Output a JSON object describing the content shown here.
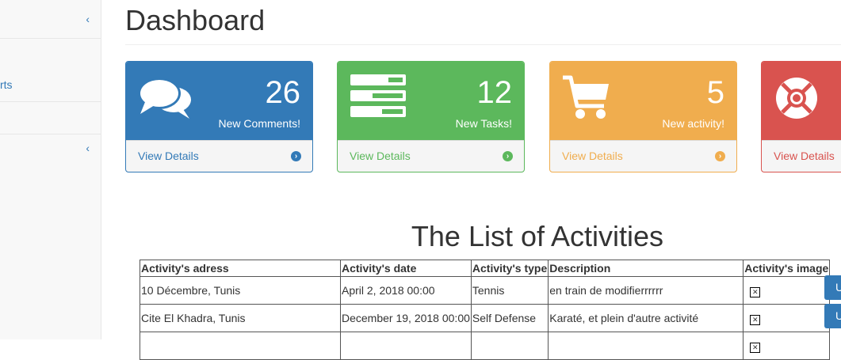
{
  "sidebar": {
    "items": [
      {
        "label": "",
        "chevron": "‹"
      },
      {
        "label": "rts",
        "chevron": ""
      },
      {
        "label": "",
        "chevron": ""
      },
      {
        "label": "",
        "chevron": "‹"
      }
    ]
  },
  "page": {
    "title": "Dashboard"
  },
  "panels": [
    {
      "count": "26",
      "label": "New Comments!",
      "footer": "View Details",
      "icon": "comments-icon",
      "color": "#337ab7"
    },
    {
      "count": "12",
      "label": "New Tasks!",
      "footer": "View Details",
      "icon": "tasks-icon",
      "color": "#5cb85c"
    },
    {
      "count": "5",
      "label": "New activity!",
      "footer": "View Details",
      "icon": "shopping-cart-icon",
      "color": "#f0ad4e"
    },
    {
      "count": "",
      "label": "",
      "footer": "View Details",
      "icon": "life-ring-icon",
      "color": "#d9534f"
    }
  ],
  "activities": {
    "title": "The List of Activities",
    "columns": [
      "Activity's adress",
      "Activity's date",
      "Activity's type",
      "Description",
      "Activity's image"
    ],
    "rows": [
      {
        "adress": "10 Décembre, Tunis",
        "date": "April 2, 2018 00:00",
        "type": "Tennis",
        "description": "en train de modifierrrrrr",
        "button": "U"
      },
      {
        "adress": "Cite El Khadra, Tunis",
        "date": "December 19, 2018 00:00",
        "type": "Self Defense",
        "description": "Karaté, et plein d'autre activité",
        "button": "U"
      }
    ]
  }
}
